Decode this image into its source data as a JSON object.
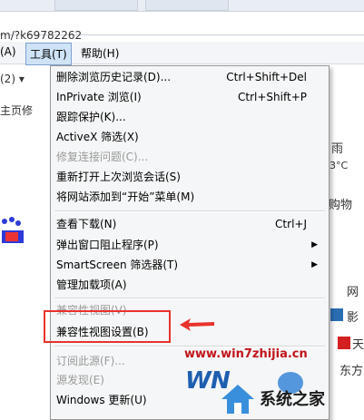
{
  "browser": {
    "address_fragment": "m/?k69782262",
    "menubar": {
      "edit_fragment": "(A)",
      "tools": "工具(T)",
      "help": "帮助(H)"
    },
    "bg_left": [
      "(2) ▾",
      "主页修",
      "",
      ""
    ],
    "bg_right": {
      "weather": "雨",
      "temp": "3°C",
      "shopping": "购物",
      "net": "网",
      "video": "影",
      "sky": "天",
      "east": "东方"
    }
  },
  "tools_menu": {
    "items": [
      {
        "label": "删除浏览历史记录(D)...",
        "shortcut": "Ctrl+Shift+Del",
        "disabled": false
      },
      {
        "label": "InPrivate 浏览(I)",
        "shortcut": "Ctrl+Shift+P",
        "disabled": false
      },
      {
        "label": "跟踪保护(K)...",
        "shortcut": "",
        "disabled": false
      },
      {
        "label": "ActiveX 筛选(X)",
        "shortcut": "",
        "disabled": false
      },
      {
        "label": "修复连接问题(C)...",
        "shortcut": "",
        "disabled": true
      },
      {
        "label": "重新打开上次浏览会话(S)",
        "shortcut": "",
        "disabled": false
      },
      {
        "label": "将网站添加到“开始”菜单(M)",
        "shortcut": "",
        "disabled": false
      },
      {
        "label": "查看下载(N)",
        "shortcut": "Ctrl+J",
        "disabled": false
      },
      {
        "label": "弹出窗口阻止程序(P)",
        "shortcut": "",
        "disabled": false,
        "submenu": true
      },
      {
        "label": "SmartScreen 筛选器(T)",
        "shortcut": "",
        "disabled": false,
        "submenu": true
      },
      {
        "label": "管理加载项(A)",
        "shortcut": "",
        "disabled": false
      },
      {
        "label": "兼容性视图(V)",
        "shortcut": "",
        "disabled": true
      },
      {
        "label": "兼容性视图设置(B)",
        "shortcut": "",
        "disabled": false
      },
      {
        "label": "订阅此源(F)...",
        "shortcut": "",
        "disabled": true
      },
      {
        "label": "源发现(E)",
        "shortcut": "",
        "disabled": true
      },
      {
        "label": "Windows 更新(U)",
        "shortcut": "",
        "disabled": false
      }
    ]
  },
  "watermark": {
    "url": "www.win7zhijia.cn",
    "brand": "系统之家"
  },
  "colors": {
    "highlight_box": "#e8322b",
    "menu_bg": "#f5f6f7",
    "menubar_active": "#cfe3f7"
  }
}
